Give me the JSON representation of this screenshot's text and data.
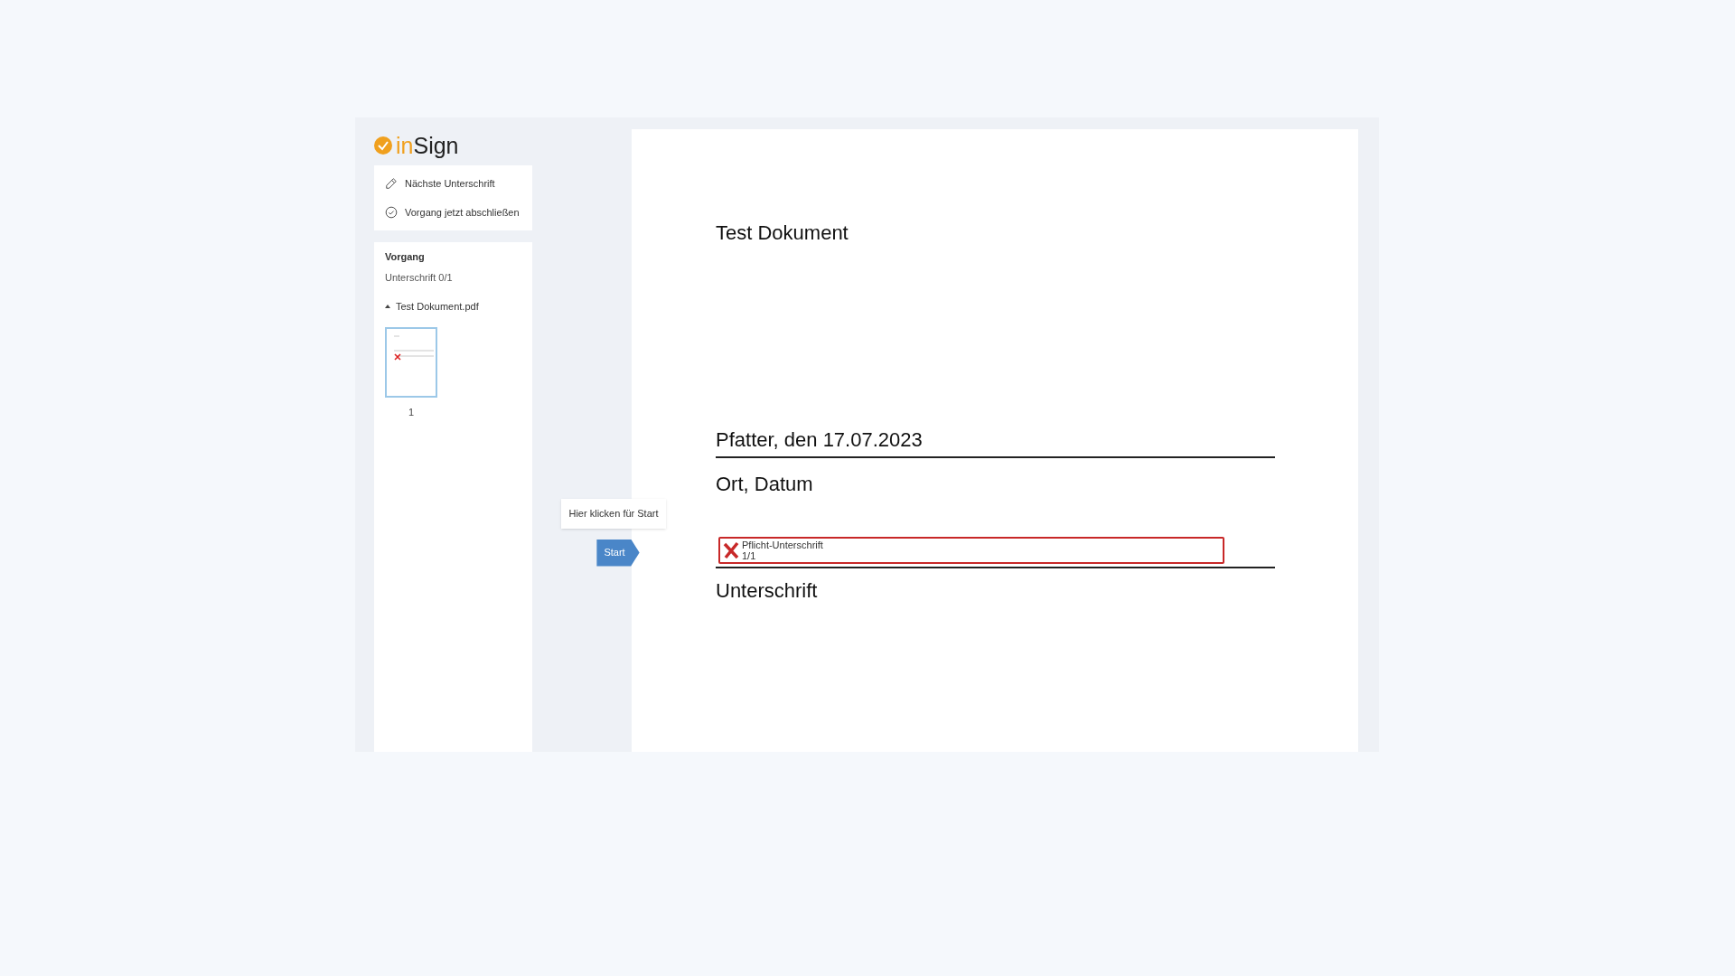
{
  "logo": {
    "prefix": "in",
    "name": "Sign"
  },
  "actions": [
    {
      "kind": "pen",
      "label": "Nächste Unterschrift"
    },
    {
      "kind": "check",
      "label": "Vorgang jetzt abschließen"
    }
  ],
  "process": {
    "title": "Vorgang",
    "status": "Unterschrift 0/1",
    "document": {
      "name": "Test Dokument.pdf",
      "expanded": true,
      "pages": [
        {
          "number": "1",
          "selected": true
        }
      ]
    }
  },
  "start": {
    "tooltip": "Hier klicken für Start",
    "label": "Start"
  },
  "document": {
    "title": "Test Dokument",
    "place_date": "Pfatter, den 17.07.2023",
    "place_date_label": "Ort, Datum",
    "signature_field": {
      "label": "Pflicht-Unterschrift",
      "count": "1/1",
      "signed": false
    },
    "signature_label": "Unterschrift"
  }
}
